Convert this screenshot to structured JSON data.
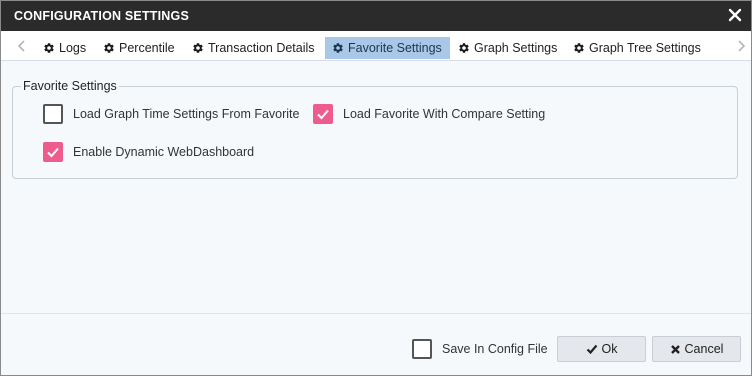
{
  "dialog": {
    "title": "CONFIGURATION SETTINGS"
  },
  "tabs": [
    {
      "label": "Logs",
      "active": false
    },
    {
      "label": "Percentile",
      "active": false
    },
    {
      "label": "Transaction Details",
      "active": false
    },
    {
      "label": "Favorite Settings",
      "active": true
    },
    {
      "label": "Graph Settings",
      "active": false
    },
    {
      "label": "Graph Tree Settings",
      "active": false
    }
  ],
  "favorite_settings": {
    "legend": "Favorite Settings",
    "options": [
      {
        "label": "Load Graph Time Settings From Favorite",
        "checked": false
      },
      {
        "label": "Load Favorite With Compare Setting",
        "checked": true
      },
      {
        "label": "Enable Dynamic WebDashboard",
        "checked": true
      }
    ]
  },
  "footer": {
    "save_in_config": {
      "label": "Save In Config File",
      "checked": false
    },
    "ok_label": "Ok",
    "cancel_label": "Cancel"
  },
  "colors": {
    "titlebar": "#2b2b2b",
    "active_tab": "#a9c8e8",
    "checkbox_checked": "#ee5c8e",
    "content_bg": "#f6f9fc"
  },
  "icons": [
    "close-icon",
    "chevron-left-icon",
    "chevron-right-icon",
    "gear-icon",
    "checkmark-icon",
    "x-icon"
  ]
}
